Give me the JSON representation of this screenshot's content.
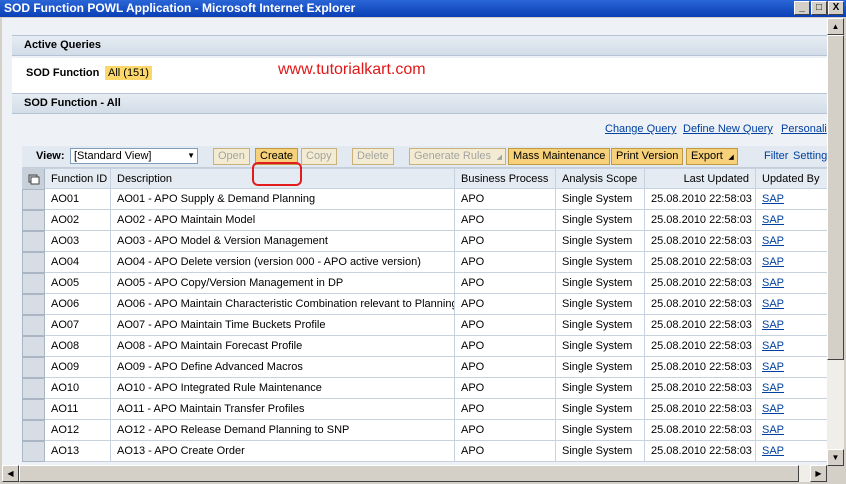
{
  "window": {
    "title": "SOD Function POWL Application - Microsoft Internet Explorer",
    "buttons": [
      "_",
      "□",
      "X"
    ]
  },
  "active_queries": {
    "header": "Active Queries",
    "query_label": "SOD Function",
    "query_badge": "All (151)",
    "watermark": "www.tutorialkart.com"
  },
  "section": {
    "header": "SOD Function - All"
  },
  "links": {
    "change_query": "Change Query",
    "define_new_query": "Define New Query",
    "personalize": "Personali"
  },
  "toolbar": {
    "view_label": "View:",
    "view_value": "[Standard View]",
    "open": "Open",
    "create": "Create",
    "copy": "Copy",
    "delete": "Delete",
    "generate_rules": "Generate Rules",
    "mass_maintenance": "Mass Maintenance",
    "print_version": "Print Version",
    "export": "Export",
    "filter": "Filter",
    "settings": "Setting"
  },
  "table": {
    "columns": [
      "Function ID",
      "Description",
      "Business Process",
      "Analysis Scope",
      "Last Updated",
      "Updated By"
    ],
    "rows": [
      {
        "id": "AO01",
        "desc": "AO01 - APO Supply & Demand Planning",
        "bp": "APO",
        "scope": "Single System",
        "updated": "25.08.2010 22:58:03",
        "by": "SAP"
      },
      {
        "id": "AO02",
        "desc": "AO02 - APO Maintain Model",
        "bp": "APO",
        "scope": "Single System",
        "updated": "25.08.2010 22:58:03",
        "by": "SAP"
      },
      {
        "id": "AO03",
        "desc": "AO03 - APO Model & Version Management",
        "bp": "APO",
        "scope": "Single System",
        "updated": "25.08.2010 22:58:03",
        "by": "SAP"
      },
      {
        "id": "AO04",
        "desc": "AO04 - APO Delete version (version 000 - APO active version)",
        "bp": "APO",
        "scope": "Single System",
        "updated": "25.08.2010 22:58:03",
        "by": "SAP"
      },
      {
        "id": "AO05",
        "desc": "AO05 - APO Copy/Version Management in DP",
        "bp": "APO",
        "scope": "Single System",
        "updated": "25.08.2010 22:58:03",
        "by": "SAP"
      },
      {
        "id": "AO06",
        "desc": "AO06 - APO Maintain Characteristic Combination relevant to Planning",
        "bp": "APO",
        "scope": "Single System",
        "updated": "25.08.2010 22:58:03",
        "by": "SAP"
      },
      {
        "id": "AO07",
        "desc": "AO07 - APO Maintain Time Buckets Profile",
        "bp": "APO",
        "scope": "Single System",
        "updated": "25.08.2010 22:58:03",
        "by": "SAP"
      },
      {
        "id": "AO08",
        "desc": "AO08 - APO Maintain Forecast Profile",
        "bp": "APO",
        "scope": "Single System",
        "updated": "25.08.2010 22:58:03",
        "by": "SAP"
      },
      {
        "id": "AO09",
        "desc": "AO09 - APO Define Advanced Macros",
        "bp": "APO",
        "scope": "Single System",
        "updated": "25.08.2010 22:58:03",
        "by": "SAP"
      },
      {
        "id": "AO10",
        "desc": "AO10 - APO Integrated Rule Maintenance",
        "bp": "APO",
        "scope": "Single System",
        "updated": "25.08.2010 22:58:03",
        "by": "SAP"
      },
      {
        "id": "AO11",
        "desc": "AO11 - APO Maintain Transfer Profiles",
        "bp": "APO",
        "scope": "Single System",
        "updated": "25.08.2010 22:58:03",
        "by": "SAP"
      },
      {
        "id": "AO12",
        "desc": "AO12 - APO Release Demand Planning to SNP",
        "bp": "APO",
        "scope": "Single System",
        "updated": "25.08.2010 22:58:03",
        "by": "SAP"
      },
      {
        "id": "AO13",
        "desc": "AO13 - APO Create Order",
        "bp": "APO",
        "scope": "Single System",
        "updated": "25.08.2010 22:58:03",
        "by": "SAP"
      }
    ]
  },
  "colors": {
    "title_bar": "#0a3fb5",
    "badge": "#fcd86a",
    "highlight_ring": "#e21c1c",
    "link": "#0040a0"
  }
}
